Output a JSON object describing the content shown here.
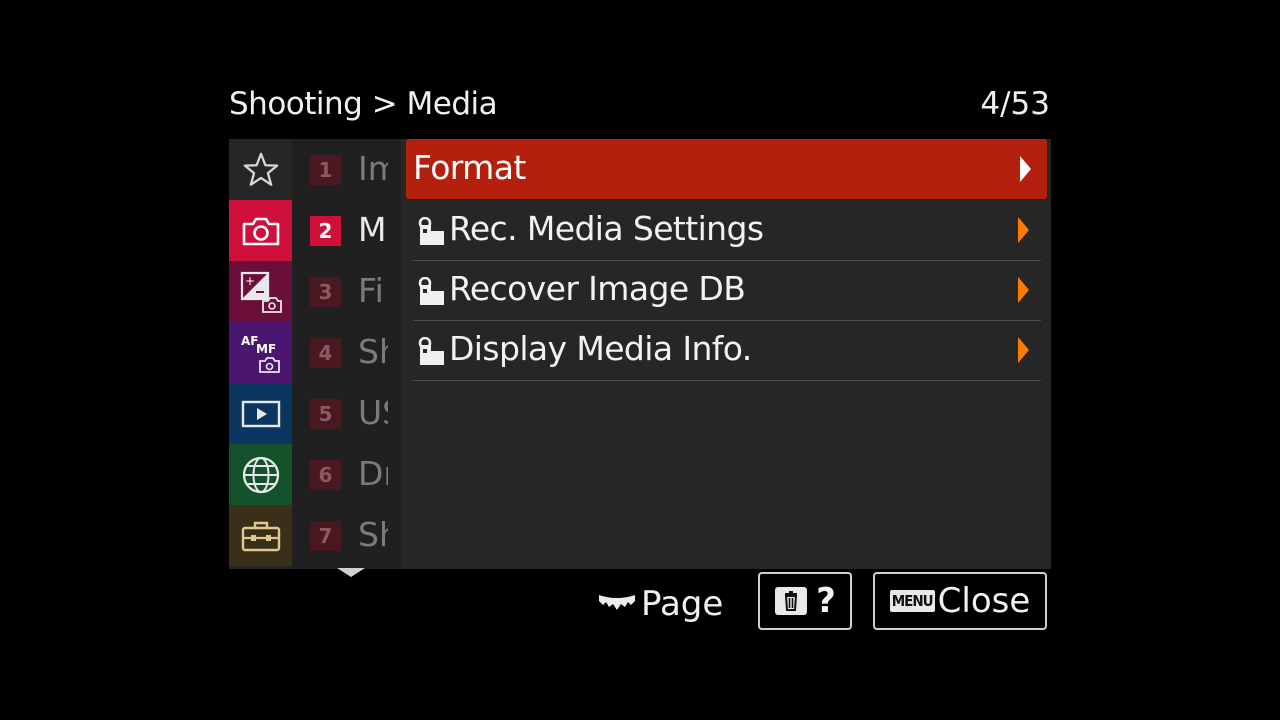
{
  "header": {
    "breadcrumb": "Shooting > Media",
    "page_indicator": "4/53"
  },
  "categories": [
    {
      "name": "my-menu",
      "icon": "star-icon",
      "color": "#262626"
    },
    {
      "name": "shooting",
      "icon": "camera-icon",
      "color": "#d0103c",
      "active": true
    },
    {
      "name": "exposure-color",
      "icon": "exposure-compensation-icon",
      "color": "#6a0f3a"
    },
    {
      "name": "focus",
      "icon": "af-mf-icon",
      "color": "#4a1670"
    },
    {
      "name": "playback",
      "icon": "play-icon",
      "color": "#0a3660"
    },
    {
      "name": "network",
      "icon": "globe-icon",
      "color": "#13522a"
    },
    {
      "name": "setup",
      "icon": "toolbox-icon",
      "color": "#3a2f18"
    }
  ],
  "pages": [
    {
      "num": "1",
      "label": "Im"
    },
    {
      "num": "2",
      "label": "M",
      "active": true
    },
    {
      "num": "3",
      "label": "Fi"
    },
    {
      "num": "4",
      "label": "Sh"
    },
    {
      "num": "5",
      "label": "US"
    },
    {
      "num": "6",
      "label": "Dr"
    },
    {
      "num": "7",
      "label": "Sh"
    }
  ],
  "menu": {
    "items": [
      {
        "label": "Format",
        "selected": true
      },
      {
        "label": "Rec. Media Settings"
      },
      {
        "label": "Recover Image DB"
      },
      {
        "label": "Display Media Info."
      }
    ]
  },
  "footer": {
    "page_label": "Page",
    "help_label": "?",
    "menu_key": "MENU",
    "close_label": "Close"
  },
  "colors": {
    "selected": "#b3200e",
    "arrow": "#ff7a00",
    "active_page": "#d0103c"
  }
}
